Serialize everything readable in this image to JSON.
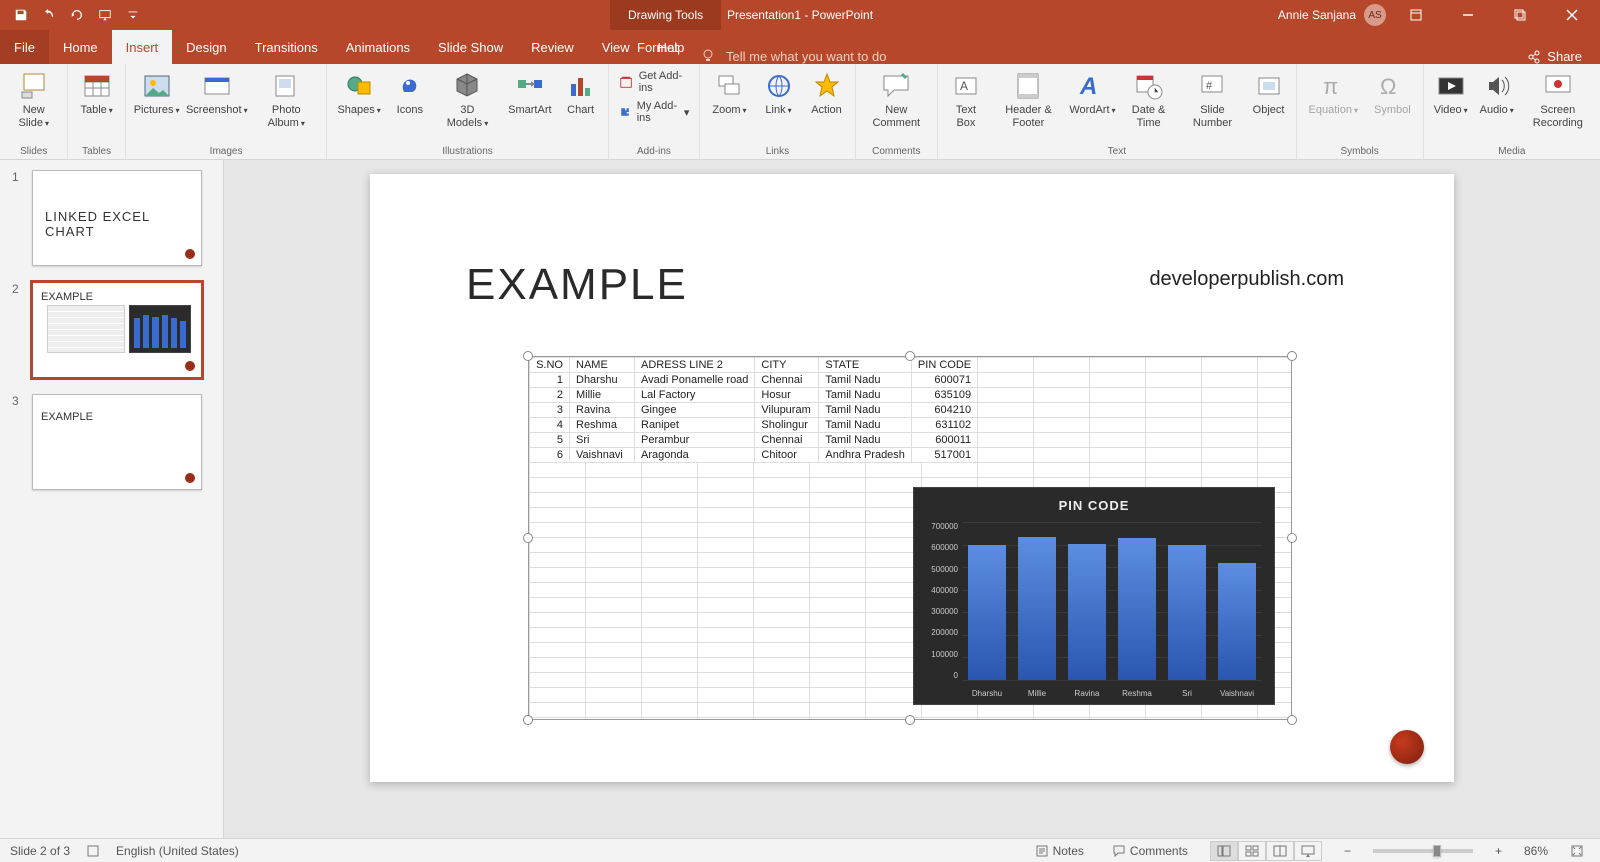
{
  "titlebar": {
    "doc_title": "Presentation1 - PowerPoint",
    "context_tools": "Drawing Tools",
    "user_name": "Annie Sanjana",
    "user_initials": "AS"
  },
  "ribbon_tabs": {
    "file": "File",
    "home": "Home",
    "insert": "Insert",
    "design": "Design",
    "transitions": "Transitions",
    "animations": "Animations",
    "slideshow": "Slide Show",
    "review": "Review",
    "view": "View",
    "help": "Help",
    "format": "Format",
    "tell_me": "Tell me what you want to do",
    "share": "Share"
  },
  "ribbon": {
    "slides": {
      "new_slide": "New\nSlide",
      "group": "Slides"
    },
    "tables": {
      "table": "Table",
      "group": "Tables"
    },
    "images": {
      "pictures": "Pictures",
      "screenshot": "Screenshot",
      "photo_album": "Photo\nAlbum",
      "group": "Images"
    },
    "illustrations": {
      "shapes": "Shapes",
      "icons": "Icons",
      "models": "3D\nModels",
      "smartart": "SmartArt",
      "chart": "Chart",
      "group": "Illustrations"
    },
    "addins": {
      "get": "Get Add-ins",
      "my": "My Add-ins",
      "group": "Add-ins"
    },
    "links": {
      "zoom": "Zoom",
      "link": "Link",
      "action": "Action",
      "group": "Links"
    },
    "comments": {
      "new_comment": "New\nComment",
      "group": "Comments"
    },
    "text": {
      "text_box": "Text\nBox",
      "header_footer": "Header\n& Footer",
      "wordart": "WordArt",
      "date_time": "Date &\nTime",
      "slide_number": "Slide\nNumber",
      "object": "Object",
      "group": "Text"
    },
    "symbols": {
      "equation": "Equation",
      "symbol": "Symbol",
      "group": "Symbols"
    },
    "media": {
      "video": "Video",
      "audio": "Audio",
      "screen_recording": "Screen\nRecording",
      "group": "Media"
    }
  },
  "thumbs": {
    "t1": "LINKED EXCEL CHART",
    "t2": "EXAMPLE",
    "t3": "EXAMPLE"
  },
  "slide": {
    "title": "EXAMPLE",
    "url": "developerpublish.com",
    "table": {
      "headers": [
        "S.NO",
        "NAME",
        "ADRESS LINE 2",
        "CITY",
        "STATE",
        "PIN CODE"
      ],
      "rows": [
        [
          "1",
          "Dharshu",
          "Avadi Ponamelle road",
          "Chennai",
          "Tamil Nadu",
          "600071"
        ],
        [
          "2",
          "Millie",
          "Lal Factory",
          "Hosur",
          "Tamil Nadu",
          "635109"
        ],
        [
          "3",
          "Ravina",
          "Gingee",
          "Vilupuram",
          "Tamil Nadu",
          "604210"
        ],
        [
          "4",
          "Reshma",
          "Ranipet",
          "Sholingur",
          "Tamil Nadu",
          "631102"
        ],
        [
          "5",
          "Sri",
          "Perambur",
          "Chennai",
          "Tamil Nadu",
          "600011"
        ],
        [
          "6",
          "Vaishnavi",
          "Aragonda",
          "Chitoor",
          "Andhra Pradesh",
          "517001"
        ]
      ]
    }
  },
  "chart_data": {
    "type": "bar",
    "title": "PIN CODE",
    "categories": [
      "Dharshu",
      "Millie",
      "Ravina",
      "Reshma",
      "Sri",
      "Vaishnavi"
    ],
    "values": [
      600071,
      635109,
      604210,
      631102,
      600011,
      517001
    ],
    "ylim": [
      0,
      700000
    ],
    "yticks": [
      "700000",
      "600000",
      "500000",
      "400000",
      "300000",
      "200000",
      "100000",
      "0"
    ]
  },
  "status": {
    "slide_pos": "Slide 2 of 3",
    "language": "English (United States)",
    "notes": "Notes",
    "comments": "Comments",
    "zoom": "86%"
  }
}
